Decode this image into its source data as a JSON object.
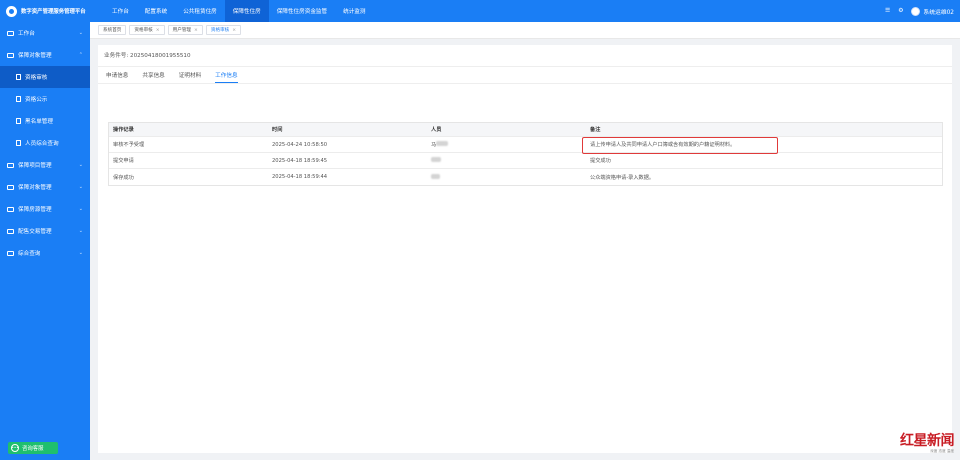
{
  "app": {
    "title": "数字资产管理服务管理平台"
  },
  "topnav": [
    {
      "label": "工作台",
      "active": false
    },
    {
      "label": "配置系统",
      "active": false
    },
    {
      "label": "公共租赁住房",
      "active": false
    },
    {
      "label": "保障性住房",
      "active": true
    },
    {
      "label": "保障性住房资金监管",
      "active": false
    },
    {
      "label": "统计监测",
      "active": false
    }
  ],
  "user": {
    "name": "系统运维02"
  },
  "sidebar": {
    "items": [
      {
        "label": "工作台",
        "type": "folder",
        "chevron": "⌄"
      },
      {
        "label": "保障对象管理",
        "type": "folder",
        "chevron": "⌃"
      },
      {
        "label": "资格审核",
        "type": "doc",
        "active": true
      },
      {
        "label": "资格公示",
        "type": "doc"
      },
      {
        "label": "黑名单管理",
        "type": "doc"
      },
      {
        "label": "人员综合查询",
        "type": "doc"
      },
      {
        "label": "保障项目管理",
        "type": "folder",
        "chevron": "⌄"
      },
      {
        "label": "保障对象管理",
        "type": "folder",
        "chevron": "⌄"
      },
      {
        "label": "保障房源管理",
        "type": "folder",
        "chevron": "⌄"
      },
      {
        "label": "配售交易管理",
        "type": "folder",
        "chevron": "⌄"
      },
      {
        "label": "综合查询",
        "type": "folder",
        "chevron": "⌄"
      }
    ],
    "help_label": "咨询客服"
  },
  "pagetabs": [
    {
      "label": "系统首页",
      "closable": false,
      "active": false
    },
    {
      "label": "资格审核",
      "closable": true,
      "active": false
    },
    {
      "label": "用户管理",
      "closable": true,
      "active": false
    },
    {
      "label": "资格审核",
      "closable": true,
      "active": true
    }
  ],
  "business": {
    "label": "业务件号:",
    "number": "2025041800195551​0"
  },
  "subtabs": [
    {
      "label": "申请信息",
      "active": false
    },
    {
      "label": "共享信息",
      "active": false
    },
    {
      "label": "证明材料",
      "active": false
    },
    {
      "label": "工作信息",
      "active": true
    }
  ],
  "table": {
    "headers": [
      "操作记录",
      "时间",
      "人员",
      "备注"
    ],
    "rows": [
      {
        "action": "审核不予受理",
        "time": "2025-04-24 10:58:50",
        "person": "马",
        "note": "请上传申请人及共同申请人户口簿或含有效期的户籍证明材料。",
        "highlight": true
      },
      {
        "action": "提交申请",
        "time": "2025-04-18 18:59:45",
        "person": "",
        "note": "提交成功",
        "highlight": false
      },
      {
        "action": "保存成功",
        "time": "2025-04-18 18:59:44",
        "person": "",
        "note": "公众端资格申请-录入数据。",
        "highlight": false
      }
    ]
  },
  "watermark": {
    "main": "红星新闻",
    "sub": "深度 态度 温度"
  },
  "colors": {
    "primary": "#1a7ef5",
    "highlight_border": "#e03a3a",
    "help": "#1fbf6e",
    "watermark": "#c81d25"
  }
}
